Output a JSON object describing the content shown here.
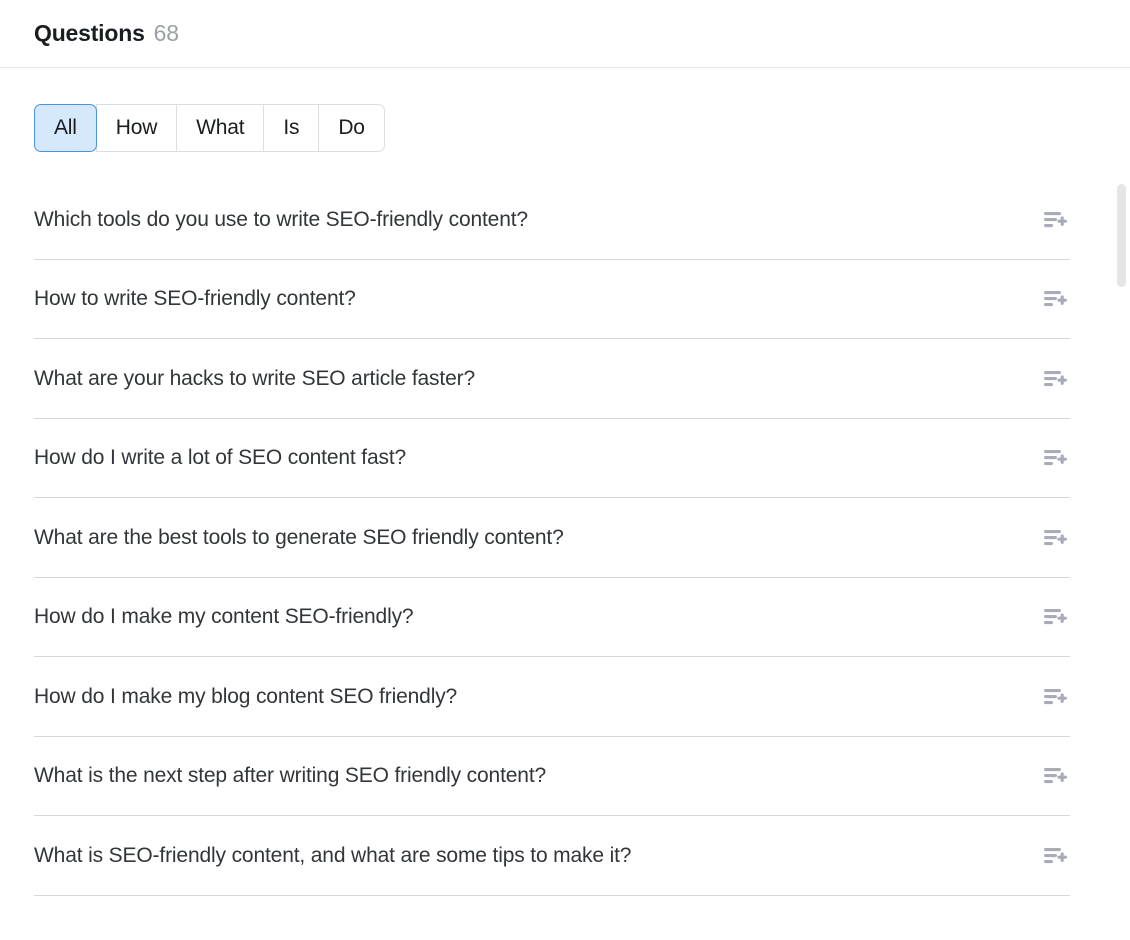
{
  "header": {
    "title": "Questions",
    "count": "68"
  },
  "filters": {
    "tabs": [
      {
        "label": "All",
        "active": true
      },
      {
        "label": "How",
        "active": false
      },
      {
        "label": "What",
        "active": false
      },
      {
        "label": "Is",
        "active": false
      },
      {
        "label": "Do",
        "active": false
      }
    ],
    "active_tab": "All"
  },
  "colors": {
    "active_tab_bg": "#d6e8fc",
    "active_tab_border": "#4a93e8",
    "tab_border": "#dcdee3",
    "row_divider": "#d6d7dc",
    "header_divider": "#e3e4e8",
    "text_primary": "#1a1d21",
    "text_row": "#32363b",
    "text_muted": "#9aa0a6",
    "icon": "#a8abb8",
    "scrollbar_thumb": "#e4e5e6"
  },
  "questions": [
    {
      "text": "Which tools do you use to write SEO-friendly content?",
      "action_icon": "add-to-list-icon"
    },
    {
      "text": "How to write SEO-friendly content?",
      "action_icon": "add-to-list-icon"
    },
    {
      "text": "What are your hacks to write SEO article faster?",
      "action_icon": "add-to-list-icon"
    },
    {
      "text": "How do I write a lot of SEO content fast?",
      "action_icon": "add-to-list-icon"
    },
    {
      "text": "What are the best tools to generate SEO friendly content?",
      "action_icon": "add-to-list-icon"
    },
    {
      "text": "How do I make my content SEO-friendly?",
      "action_icon": "add-to-list-icon"
    },
    {
      "text": "How do I make my blog content SEO friendly?",
      "action_icon": "add-to-list-icon"
    },
    {
      "text": "What is the next step after writing SEO friendly content?",
      "action_icon": "add-to-list-icon"
    },
    {
      "text": "What is SEO-friendly content, and what are some tips to make it?",
      "action_icon": "add-to-list-icon"
    }
  ],
  "scrollbar": {
    "name": "questions-list-scrollbar",
    "orientation": "vertical"
  }
}
